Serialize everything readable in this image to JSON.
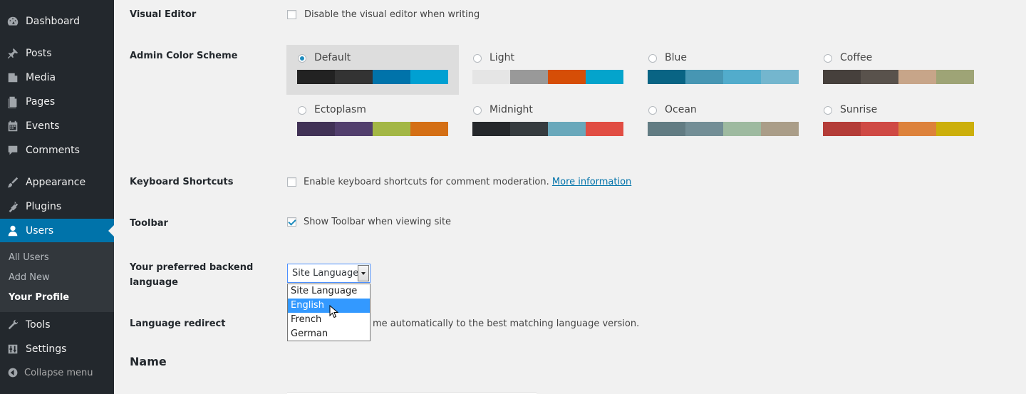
{
  "sidebar": {
    "items": [
      {
        "label": "Dashboard",
        "icon": "dashboard-icon"
      },
      {
        "label": "Posts",
        "icon": "pin-icon"
      },
      {
        "label": "Media",
        "icon": "media-icon"
      },
      {
        "label": "Pages",
        "icon": "pages-icon"
      },
      {
        "label": "Events",
        "icon": "calendar-icon"
      },
      {
        "label": "Comments",
        "icon": "comment-icon"
      },
      {
        "label": "Appearance",
        "icon": "brush-icon"
      },
      {
        "label": "Plugins",
        "icon": "plug-icon"
      },
      {
        "label": "Users",
        "icon": "user-icon"
      },
      {
        "label": "Tools",
        "icon": "wrench-icon"
      },
      {
        "label": "Settings",
        "icon": "settings-icon"
      }
    ],
    "submenu": [
      "All Users",
      "Add New",
      "Your Profile"
    ],
    "collapse_label": "Collapse menu"
  },
  "profile": {
    "visual_editor": {
      "label": "Visual Editor",
      "checkbox_text": "Disable the visual editor when writing",
      "checked": false
    },
    "color_scheme": {
      "label": "Admin Color Scheme",
      "selected": "Default",
      "schemes": [
        {
          "name": "Default",
          "colors": [
            "#222222",
            "#333333",
            "#0073aa",
            "#00a0d2"
          ]
        },
        {
          "name": "Light",
          "colors": [
            "#e5e5e5",
            "#999999",
            "#d64e07",
            "#04a4cc"
          ]
        },
        {
          "name": "Blue",
          "colors": [
            "#096484",
            "#4796b3",
            "#52accc",
            "#74b6ce"
          ]
        },
        {
          "name": "Coffee",
          "colors": [
            "#46403c",
            "#59524c",
            "#c7a589",
            "#9ea476"
          ]
        },
        {
          "name": "Ectoplasm",
          "colors": [
            "#413256",
            "#523f6d",
            "#a3b745",
            "#d46f15"
          ]
        },
        {
          "name": "Midnight",
          "colors": [
            "#25282b",
            "#363b3f",
            "#69a8bb",
            "#e14d43"
          ]
        },
        {
          "name": "Ocean",
          "colors": [
            "#627c83",
            "#738e96",
            "#9ebaa0",
            "#aa9d88"
          ]
        },
        {
          "name": "Sunrise",
          "colors": [
            "#b43c38",
            "#cf4944",
            "#dd823b",
            "#ccaf0b"
          ]
        }
      ]
    },
    "keyboard_shortcuts": {
      "label": "Keyboard Shortcuts",
      "checkbox_text": "Enable keyboard shortcuts for comment moderation.",
      "link_text": "More information",
      "checked": false
    },
    "toolbar": {
      "label": "Toolbar",
      "checkbox_text": "Show Toolbar when viewing site",
      "checked": true
    },
    "backend_language": {
      "label_line1": "Your preferred backend",
      "label_line2": "language",
      "selected": "Site Language",
      "options": [
        "Site Language",
        "English",
        "French",
        "German"
      ],
      "highlighted": "English"
    },
    "language_redirect": {
      "label": "Language redirect",
      "text_visible": "me automatically to the best matching language version."
    },
    "name_section_title": "Name"
  }
}
